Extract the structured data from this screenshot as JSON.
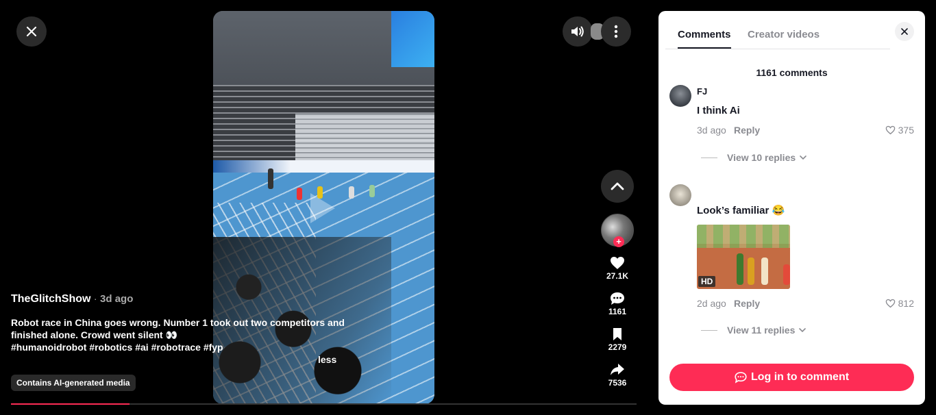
{
  "video": {
    "author": "TheGlitchShow",
    "separator": "·",
    "posted": "3d ago",
    "description_line1": "Robot race in China goes wrong. Number 1 took out two competitors and",
    "description_line2": "finished alone. Crowd went silent 👀",
    "hashtags": "#humanoidrobot #robotics #ai #robotrace #fyp",
    "less_label": "less",
    "ai_badge": "Contains AI-generated media",
    "progress_fraction": 0.19
  },
  "actions": {
    "likes": "27.1K",
    "comments": "1161",
    "saves": "2279",
    "shares": "7536",
    "follow_plus": "+"
  },
  "panel": {
    "tabs": [
      "Comments",
      "Creator videos"
    ],
    "comment_count": "1161 comments",
    "comments": [
      {
        "name": "FJ",
        "text": "I think Ai",
        "time": "3d ago",
        "reply": "Reply",
        "likes": "375",
        "view_replies": "View 10 replies"
      },
      {
        "name": "",
        "text": "Look’s familiar 😂",
        "time": "2d ago",
        "reply": "Reply",
        "likes": "812",
        "view_replies": "View 11 replies",
        "media_badge": "HD"
      }
    ],
    "login_label": "Log in to comment"
  },
  "colors": {
    "accent": "#fe2c55",
    "background": "#000000",
    "panel": "#ffffff"
  }
}
